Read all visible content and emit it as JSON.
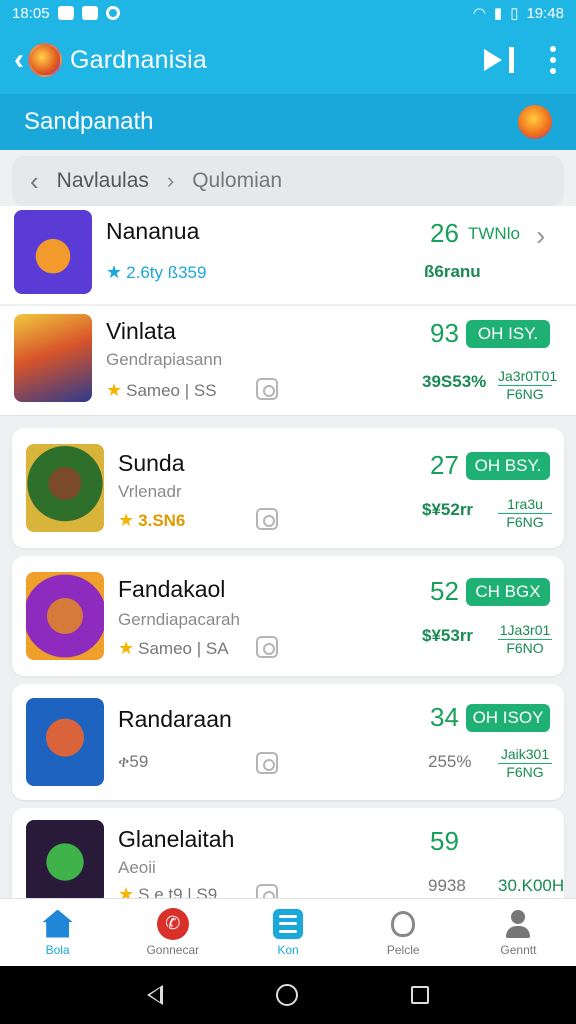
{
  "statusbar": {
    "time": "18:05",
    "time_right": "19:48"
  },
  "appbar": {
    "title": "Gardnanisia"
  },
  "subheader": {
    "title": "Sandpanath"
  },
  "breadcrumb": {
    "parent": "Navlaulas",
    "current": "Qulomian"
  },
  "rows": [
    {
      "name": "Nananua",
      "rating_text": "2.6ty ß359",
      "score": "26",
      "score_label": "TWNlo",
      "stat_left": "ß6ranu"
    },
    {
      "name": "Vinlata",
      "subtitle": "Gendrapiasann",
      "rating_text": "Sameo | SS",
      "score": "93",
      "pill": "OH ISY.",
      "stat_left": "39S53%",
      "stat_top": "Ja3r0T01",
      "stat_bottom": "F6NG"
    },
    {
      "name": "Sunda",
      "subtitle": "Vrlenadr",
      "rating_text": "3.SN6",
      "score": "27",
      "pill": "OH BSY.",
      "stat_left": "$¥52rr",
      "stat_top": "1ra3u",
      "stat_bottom": "F6NG"
    },
    {
      "name": "Fandakaol",
      "subtitle": "Gerndiapacarah",
      "rating_text": "Sameo | SA",
      "score": "52",
      "pill": "CH BGX",
      "stat_left": "$¥53rr",
      "stat_top": "1Ja3r01",
      "stat_bottom": "F6NO"
    },
    {
      "name": "Randaraan",
      "rating_text": "ቀ59",
      "score": "34",
      "pill": "OH ISOY",
      "stat_left": "255%",
      "stat_top": "Jaik301",
      "stat_bottom": "F6NG"
    },
    {
      "name": "Glanelaitah",
      "subtitle": "Aeoii",
      "rating_text": "S.e.t9 | S9",
      "score": "59",
      "stat_left": "9938",
      "stat_right": "30.K00H"
    }
  ],
  "bottomnav": [
    {
      "label": "Bola"
    },
    {
      "label": "Gonnecar"
    },
    {
      "label": "Kon"
    },
    {
      "label": "Pelcle"
    },
    {
      "label": "Genntt"
    }
  ],
  "colors": {
    "primary": "#1fb6e6",
    "accent_green": "#1fb173",
    "score_green": "#18a05a"
  }
}
